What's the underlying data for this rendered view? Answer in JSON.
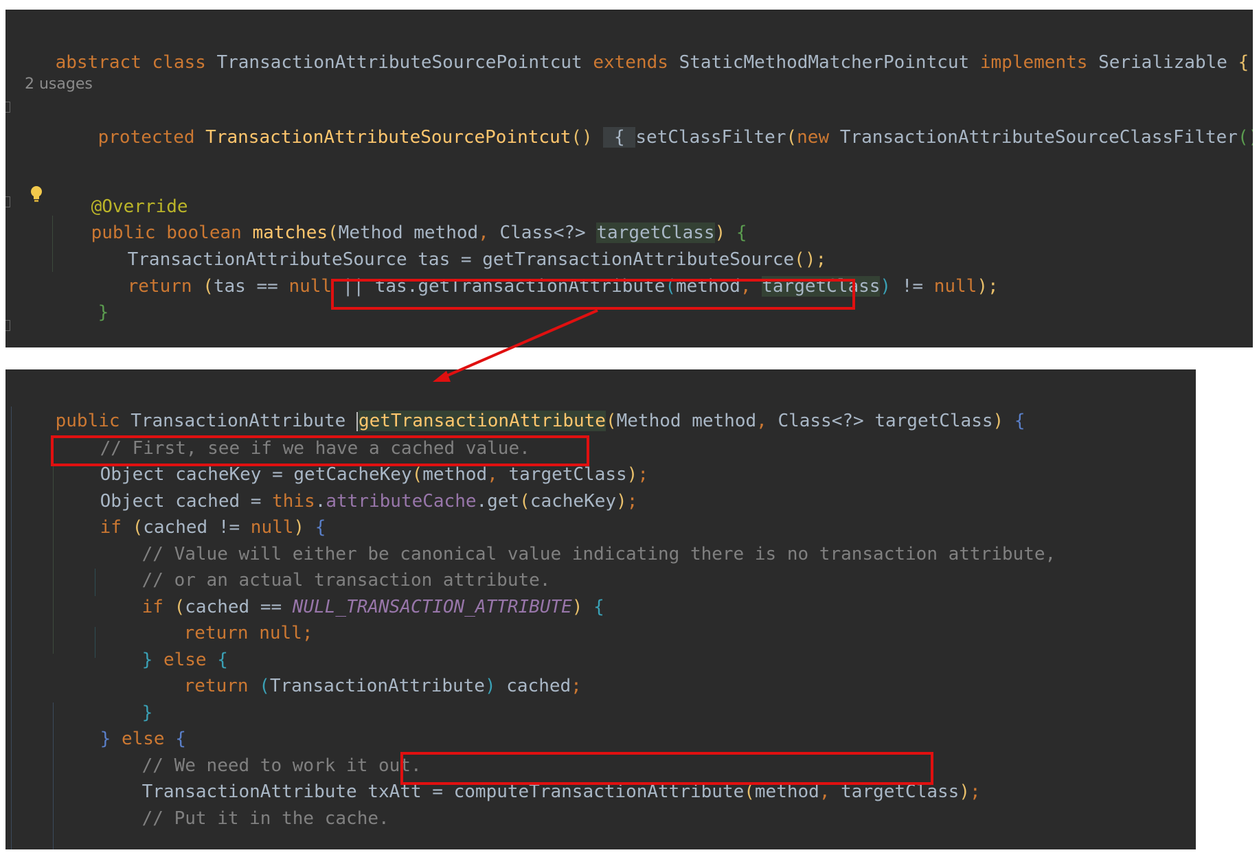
{
  "top": {
    "l1": {
      "kw1": "abstract",
      "kw2": "class",
      "name": "TransactionAttributeSourcePointcut",
      "kw3": "extends",
      "parent": "StaticMethodMatcherPointcut",
      "kw4": "implements",
      "iface": "Serializable",
      "brace": "{"
    },
    "usages": "2 usages",
    "l2": {
      "kw": "protected",
      "ctor": "TransactionAttributeSourcePointcut",
      "parens": "()",
      "ob": "{",
      "call": "setClassFilter",
      "op": "(",
      "kw_new": "new",
      "cls": "TransactionAttributeSourceClassFilter",
      "cp": "()",
      "end": ");",
      "cb": "}"
    },
    "l3": {
      "ann": "@Override"
    },
    "l4": {
      "kw1": "public",
      "kw2": "boolean",
      "name": "matches",
      "op": "(",
      "t1": "Method",
      "p1": "method",
      "comma": ",",
      "t2": "Class<?>",
      "p2": "targetClass",
      "cp": ")",
      "ob": "{"
    },
    "l5": {
      "type": "TransactionAttributeSource",
      "var": "tas",
      "eq": "=",
      "call": "getTransactionAttributeSource",
      "end": "();"
    },
    "l6": {
      "kw": "return",
      "op": "(",
      "var": "tas",
      "eq": "==",
      "nul1": "null",
      "or": "||",
      "call": "tas.getTransactionAttribute",
      "op2": "(",
      "a1": "method",
      "comma": ",",
      "a2": "targetClass",
      "cp": ")",
      "ne": "!=",
      "nul2": "null",
      "end": ");"
    },
    "l7": {
      "cb": "}"
    }
  },
  "bottom": {
    "l1": {
      "kw": "public",
      "type": "TransactionAttribute",
      "name": "getTransactionAttribute",
      "op": "(",
      "t1": "Method",
      "p1": "method",
      "comma": ",",
      "t2": "Class<?>",
      "p2": "targetClass",
      "cp": ")",
      "ob": "{"
    },
    "l2": {
      "cmt": "// First, see if we have a cached value."
    },
    "l3": {
      "type": "Object",
      "var": "cacheKey",
      "eq": "=",
      "call": "getCacheKey",
      "op": "(",
      "a1": "method",
      "comma": ",",
      "a2": "targetClass",
      "cp": ")",
      "end": ";"
    },
    "l4": {
      "type": "Object",
      "var": "cached",
      "eq": "=",
      "kw": "this",
      "dot": ".",
      "field": "attributeCache",
      "rest": ".get",
      "op": "(",
      "arg": "cacheKey",
      "cp": ")",
      "end": ";"
    },
    "l5": {
      "kw": "if",
      "op": "(",
      "var": "cached",
      "ne": "!=",
      "nul": "null",
      "cp": ")",
      "ob": "{"
    },
    "l6": {
      "cmt": "// Value will either be canonical value indicating there is no transaction attribute,"
    },
    "l7": {
      "cmt": "// or an actual transaction attribute."
    },
    "l8": {
      "kw": "if",
      "op": "(",
      "var": "cached",
      "eq": "==",
      "const": "NULL_TRANSACTION_ATTRIBUTE",
      "cp": ")",
      "ob": "{"
    },
    "l9": {
      "kw": "return",
      "nul": "null",
      "end": ";"
    },
    "l10": {
      "cb": "}",
      "kw": "else",
      "ob": "{"
    },
    "l11": {
      "kw": "return",
      "op": "(",
      "type": "TransactionAttribute",
      "cp": ")",
      "var": "cached",
      "end": ";"
    },
    "l12": {
      "cb": "}"
    },
    "l13": {
      "cb": "}",
      "kw": "else",
      "ob": "{"
    },
    "l14": {
      "cmt": "// We need to work it out."
    },
    "l15": {
      "type": "TransactionAttribute",
      "var": "txAtt",
      "eq": "=",
      "call": "computeTransactionAttribute",
      "op": "(",
      "a1": "method",
      "comma": ",",
      "a2": "targetClass",
      "cp": ")",
      "end": ";"
    },
    "l16": {
      "cmt": "// Put it in the cache."
    }
  },
  "colors": {
    "background": "#2b2b2b",
    "keyword": "#cc7832",
    "text": "#a9b7c6",
    "method": "#ffc66d",
    "annotation": "#bbb529",
    "comment": "#808080",
    "field": "#9876aa",
    "highlight_box": "#e01010"
  },
  "icons": {
    "lightbulb": "lightbulb-icon",
    "arrow": "annotation-arrow"
  }
}
